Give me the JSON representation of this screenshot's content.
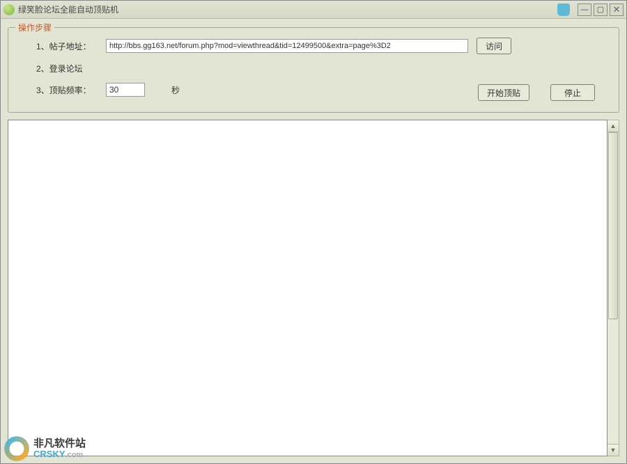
{
  "window": {
    "title": "绿笑脸论坛全能自动顶贴机"
  },
  "group": {
    "title": "操作步骤",
    "row1_label": "1、帖子地址：",
    "row2_label": "2、登录论坛",
    "row3_label": "3、顶贴频率：",
    "url_value": "http://bbs.gg163.net/forum.php?mod=viewthread&tid=12499500&extra=page%3D2",
    "freq_value": "30",
    "unit": "秒"
  },
  "buttons": {
    "visit": "访问",
    "start": "开始顶贴",
    "stop": "停止"
  },
  "watermark": {
    "cn": "非凡软件站",
    "en": "CRSKY",
    "suffix": ".com"
  }
}
